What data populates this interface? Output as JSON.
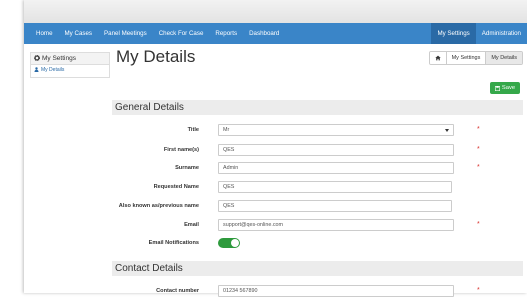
{
  "nav": {
    "left": [
      "Home",
      "My Cases",
      "Panel Meetings",
      "Check For Case",
      "Reports",
      "Dashboard"
    ],
    "right": [
      "My Settings",
      "Administration"
    ]
  },
  "sidebar": {
    "heading": "My Settings",
    "items": [
      {
        "label": "My Details"
      }
    ]
  },
  "page": {
    "title": "My Details",
    "breadcrumb": [
      "My Settings",
      "My Details"
    ],
    "save_label": "Save"
  },
  "general": {
    "heading": "General Details",
    "fields": [
      {
        "label": "Title",
        "value": "Mr",
        "type": "select",
        "required": true
      },
      {
        "label": "First name(s)",
        "value": "QES",
        "required": true
      },
      {
        "label": "Surname",
        "value": "Admin",
        "required": true
      },
      {
        "label": "Requested Name",
        "value": "QES",
        "required": false
      },
      {
        "label": "Also known as/previous name",
        "value": "QES",
        "required": false
      },
      {
        "label": "Email",
        "value": "support@qes-online.com",
        "required": true
      },
      {
        "label": "Email Notifications",
        "value": "on",
        "type": "toggle"
      }
    ]
  },
  "contact": {
    "heading": "Contact Details",
    "fields": [
      {
        "label": "Contact number",
        "value": "01234 567890",
        "required": true
      }
    ]
  },
  "colors": {
    "navbar": "#3a85c8",
    "accent": "#35a84a",
    "required": "#d9302c"
  }
}
